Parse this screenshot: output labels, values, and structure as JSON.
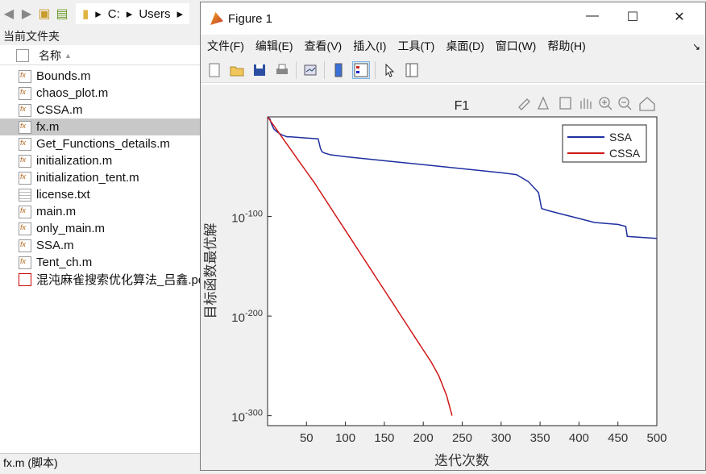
{
  "browser": {
    "path": [
      "C:",
      "Users"
    ],
    "current_folder_label": "当前文件夹",
    "column_header": "名称",
    "files": [
      {
        "name": "Bounds.m",
        "type": "m"
      },
      {
        "name": "chaos_plot.m",
        "type": "m"
      },
      {
        "name": "CSSA.m",
        "type": "m"
      },
      {
        "name": "fx.m",
        "type": "m",
        "selected": true
      },
      {
        "name": "Get_Functions_details.m",
        "type": "m"
      },
      {
        "name": "initialization.m",
        "type": "m"
      },
      {
        "name": "initialization_tent.m",
        "type": "m"
      },
      {
        "name": "license.txt",
        "type": "txt"
      },
      {
        "name": "main.m",
        "type": "m"
      },
      {
        "name": "only_main.m",
        "type": "m"
      },
      {
        "name": "SSA.m",
        "type": "m"
      },
      {
        "name": "Tent_ch.m",
        "type": "m"
      },
      {
        "name": "混沌麻雀搜索优化算法_吕鑫.pd",
        "type": "pdf"
      }
    ],
    "status": "fx.m  (脚本)"
  },
  "figure": {
    "title": "Figure 1",
    "menu": [
      "文件(F)",
      "编辑(E)",
      "查看(V)",
      "插入(I)",
      "工具(T)",
      "桌面(D)",
      "窗口(W)",
      "帮助(H)"
    ],
    "toolbar_icons": [
      "new-icon",
      "open-icon",
      "save-icon",
      "print-icon",
      "link-icon",
      "colorbar-icon",
      "legend-icon",
      "pointer-icon",
      "propertyeditor-icon"
    ],
    "axes_toolbar_icons": [
      "brush-icon",
      "datatip-icon",
      "rotate-icon",
      "pan-icon",
      "zoom-in-icon",
      "zoom-out-icon",
      "home-icon"
    ]
  },
  "chart_data": {
    "type": "line",
    "title": "F1",
    "xlabel": "迭代次数",
    "ylabel": "目标函数最优解",
    "xlim": [
      0,
      500
    ],
    "ylim_log10": [
      -310,
      0
    ],
    "yscale": "log",
    "xticks": [
      50,
      100,
      150,
      200,
      250,
      300,
      350,
      400,
      450,
      500
    ],
    "yticks_exponent": [
      -100,
      -200,
      -300
    ],
    "ytick_base": "10",
    "legend_position": "top-right",
    "series": [
      {
        "name": "SSA",
        "color": "#1f2fa0",
        "x": [
          0,
          3,
          5,
          8,
          12,
          18,
          25,
          30,
          45,
          65,
          68,
          70,
          72,
          80,
          100,
          150,
          200,
          250,
          300,
          320,
          335,
          348,
          352,
          360,
          380,
          400,
          420,
          450,
          460,
          462,
          480,
          500
        ],
        "log10_y": [
          0,
          -2,
          -7,
          -12,
          -15,
          -18,
          -20,
          -20,
          -21,
          -22,
          -32,
          -35,
          -36,
          -38,
          -40,
          -44,
          -48,
          -52,
          -56,
          -58,
          -65,
          -76,
          -92,
          -94,
          -98,
          -102,
          -106,
          -108,
          -110,
          -120,
          -121,
          -122
        ]
      },
      {
        "name": "CSSA",
        "color": "#d01818",
        "x": [
          0,
          10,
          20,
          30,
          40,
          50,
          60,
          70,
          80,
          90,
          100,
          110,
          120,
          130,
          140,
          150,
          160,
          170,
          180,
          190,
          200,
          210,
          220,
          230,
          237
        ],
        "log10_y": [
          0,
          -11,
          -22,
          -33,
          -44,
          -55,
          -66,
          -78,
          -90,
          -102,
          -114,
          -126,
          -138,
          -150,
          -162,
          -174,
          -186,
          -198,
          -210,
          -222,
          -234,
          -246,
          -260,
          -280,
          -300
        ]
      }
    ]
  }
}
